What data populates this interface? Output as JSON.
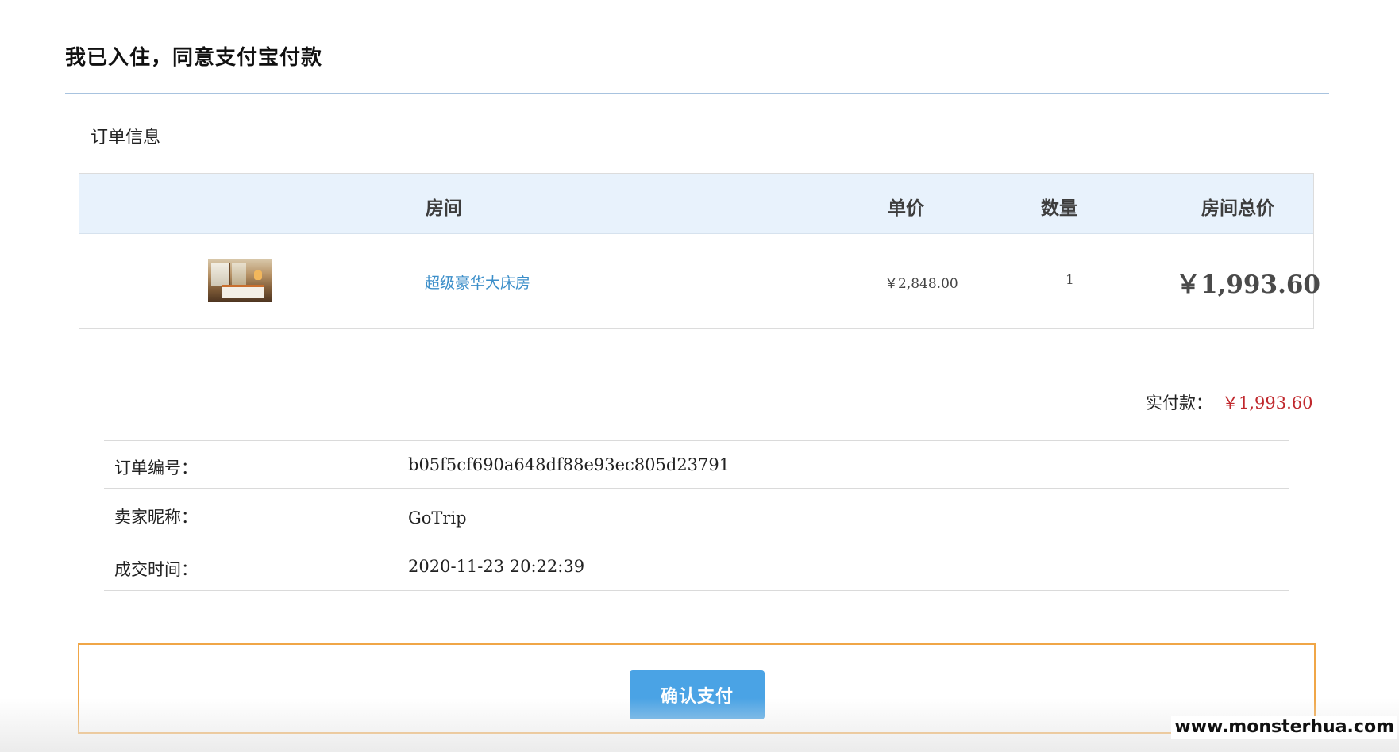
{
  "page": {
    "title": "我已入住，同意支付宝付款"
  },
  "order_section": {
    "title": "订单信息",
    "columns": [
      "房间",
      "单价",
      "数量",
      "房间总价"
    ],
    "rows": [
      {
        "thumbnail": "room-photo",
        "room": "超级豪华大床房",
        "unit_price": "￥2,848.00",
        "quantity": "1",
        "room_total": "￥1,993.60"
      }
    ]
  },
  "payment": {
    "label": "实付款：",
    "amount": "￥1,993.60",
    "amount_color": "#c0282d"
  },
  "details": [
    {
      "label": "订单编号：",
      "value": "b05f5cf690a648df88e93ec805d23791"
    },
    {
      "label": "卖家昵称：",
      "value": "GoTrip"
    },
    {
      "label": "成交时间：",
      "value": "2020-11-23 20:22:39"
    }
  ],
  "actions": {
    "confirm_label": "确认支付",
    "confirm_color": "#4aa3e5",
    "box_border_color": "#f0a647"
  },
  "watermark": "www.monsterhua.com"
}
